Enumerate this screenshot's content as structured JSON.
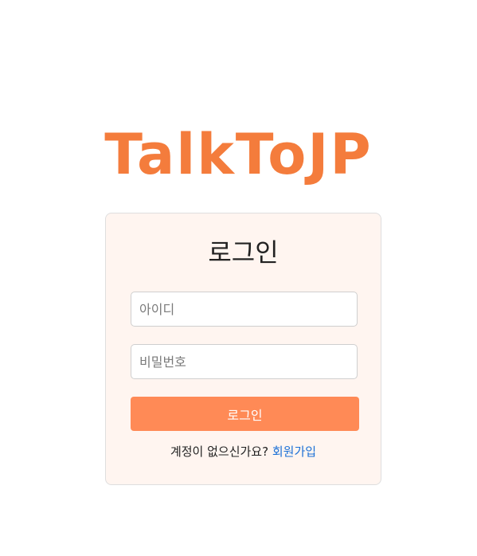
{
  "app": {
    "logo_text": "TalkToJP",
    "brand_color": "#f47c3c"
  },
  "login_form": {
    "title": "로그인",
    "id_placeholder": "아이디",
    "password_placeholder": "비밀번호",
    "submit_label": "로그인",
    "no_account_text": "계정이 없으신가요?",
    "signup_link_label": "회원가입",
    "button_color": "#ff8a56",
    "card_background": "#fff5f0",
    "link_color": "#1a6fd6"
  }
}
